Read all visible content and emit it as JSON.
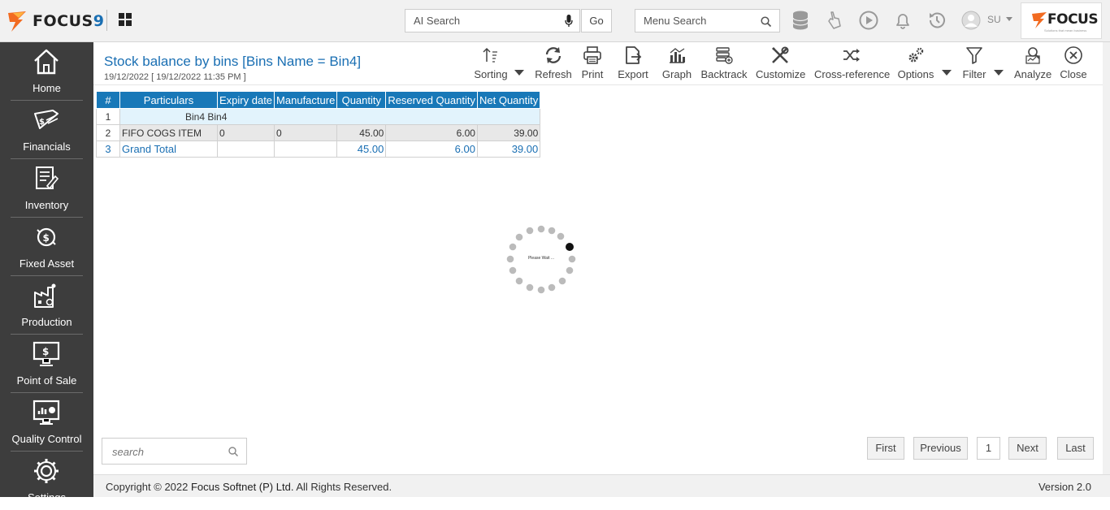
{
  "topbar": {
    "logo_text": "FOCUS",
    "logo_num": "9",
    "ai_search_placeholder": "AI Search",
    "go_label": "Go",
    "menu_search_placeholder": "Menu Search",
    "user": "SU",
    "brand_text": "FOCUS",
    "brand_tagline": "Solutions that mean business"
  },
  "sidebar": {
    "items": [
      {
        "label": "Home",
        "icon": "home-icon"
      },
      {
        "label": "Financials",
        "icon": "financials-icon"
      },
      {
        "label": "Inventory",
        "icon": "inventory-icon"
      },
      {
        "label": "Fixed Asset",
        "icon": "fixed-asset-icon"
      },
      {
        "label": "Production",
        "icon": "production-icon"
      },
      {
        "label": "Point of Sale",
        "icon": "point-of-sale-icon"
      },
      {
        "label": "Quality Control",
        "icon": "quality-control-icon"
      },
      {
        "label": "Settings",
        "icon": "settings-icon"
      }
    ]
  },
  "report": {
    "title": "Stock balance by bins [Bins Name = Bin4]",
    "date": "19/12/2022 [ 19/12/2022 11:35 PM ]"
  },
  "toolbar": {
    "sorting": "Sorting",
    "refresh": "Refresh",
    "print": "Print",
    "export": "Export",
    "graph": "Graph",
    "backtrack": "Backtrack",
    "customize": "Customize",
    "cross_reference": "Cross-reference",
    "options": "Options",
    "filter": "Filter",
    "analyze": "Analyze",
    "close": "Close"
  },
  "table": {
    "headers": [
      "#",
      "Particulars",
      "Expiry date",
      "Manufacture",
      "Quantity",
      "Reserved Quantity",
      "Net Quantity"
    ],
    "group_row": {
      "index": "1",
      "label": "Bin4 Bin4"
    },
    "data_row": {
      "index": "2",
      "particulars": "FIFO COGS ITEM",
      "expiry": "0",
      "manufacture": "0",
      "quantity": "45.00",
      "reserved": "6.00",
      "net": "39.00"
    },
    "total_row": {
      "index": "3",
      "particulars": "Grand Total",
      "quantity": "45.00",
      "reserved": "6.00",
      "net": "39.00"
    }
  },
  "spinner": {
    "text": "Please Wait ..."
  },
  "bottom": {
    "search_placeholder": "search",
    "first": "First",
    "previous": "Previous",
    "page": "1",
    "next": "Next",
    "last": "Last"
  },
  "footer": {
    "copyright_prefix": "Copyright © 2022 ",
    "company": "Focus Softnet (P) Ltd.",
    "rights": " All Rights Reserved.",
    "version_label": "Version ",
    "version": "2.0"
  },
  "colors": {
    "accent": "#1a6fb3",
    "header_bg": "#1878b8",
    "sidebar_bg": "#3d3d3d",
    "logo_orange": "#f26b21"
  }
}
